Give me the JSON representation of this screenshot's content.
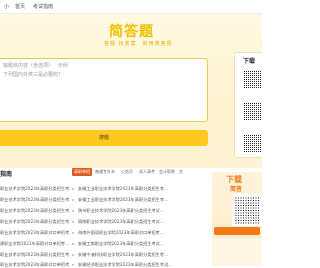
{
  "nav": {
    "items": [
      "小",
      "首页",
      "考试指南"
    ]
  },
  "hero": {
    "logo": "简答题",
    "slogan": "答题 找答案　就用简答题",
    "question_placeholder": "输题目内容（含选项）   示例\n下列国内外类三是必要的？",
    "submit_label": "搜题"
  },
  "side_download": {
    "title": "下载"
  },
  "section": {
    "title": "指南",
    "tabs": [
      "高职单招",
      "普通专升本",
      "公务员",
      "成人高考",
      "会计职称",
      "文"
    ],
    "active_tab_index": 0
  },
  "questions_left": [
    "职业技术学院2023年高职分类招生考...",
    "职业技术学院2023年高职分类招生考...",
    "职业技术学院2023年高职分类招生考...",
    "职业技术学院2023年高职分类招生考...",
    "职业技术学院2023年高职对口单招考...",
    "建职业学院2023年高职对口单招考...",
    "职业技术学院2023年高职分类招生考...",
    "职业技术学院2023年高职对口单招考..."
  ],
  "questions_right": [
    "安徽工业职业技术学院2023年高职分类招生考...",
    "安徽工业职业技术学院2023年高职分类招生考...",
    "陕州职业技术学院2023年高职分类招生考试...",
    "铜陵职业技术学院2023年高职分类招生考试...",
    "海南外国语职业学院2023年高职对口单招考...",
    "安徽工商职业学院2023年高职分类招生考试...",
    "安徽中澳科技职业学院2023年高职分类招生考...",
    "安徽经济职业技术学院2023年高职分类招生考试..."
  ],
  "promo": {
    "title": "下载",
    "subtitle": "简答"
  },
  "colors": {
    "brand_yellow": "#ffc91f",
    "accent_orange": "#e05d20",
    "promo_orange": "#f07a1a"
  }
}
